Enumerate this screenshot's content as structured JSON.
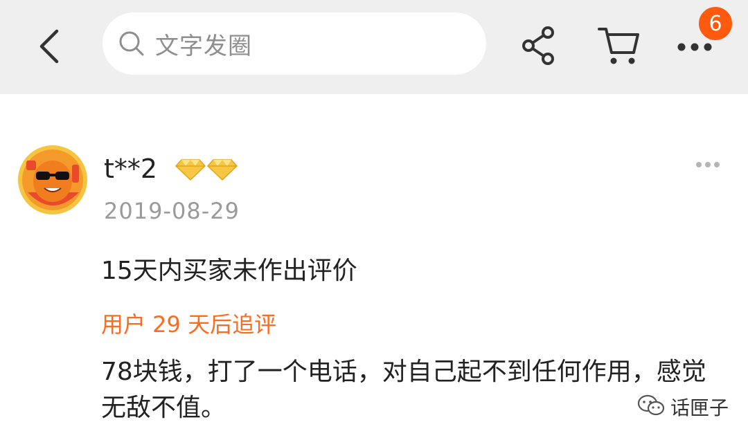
{
  "header": {
    "search_placeholder": "文字发圈",
    "badge_count": "6",
    "icons": {
      "back": "back-arrow-icon",
      "search": "search-icon",
      "share": "share-icon",
      "cart": "cart-icon",
      "more": "more-icon"
    },
    "accent_color": "#ff5a0d"
  },
  "review": {
    "username": "t**2",
    "date": "2019-08-29",
    "content": "15天内买家未作出评价",
    "followup_label": "用户 29 天后追评",
    "followup_text": "78块钱，打了一个电话，对自己起不到任何作用，感觉无敌不值。",
    "vip_icon": "diamond-icon",
    "followup_color": "#ff6a1f"
  },
  "watermark": {
    "text": "话匣子",
    "icon": "wechat-icon"
  }
}
